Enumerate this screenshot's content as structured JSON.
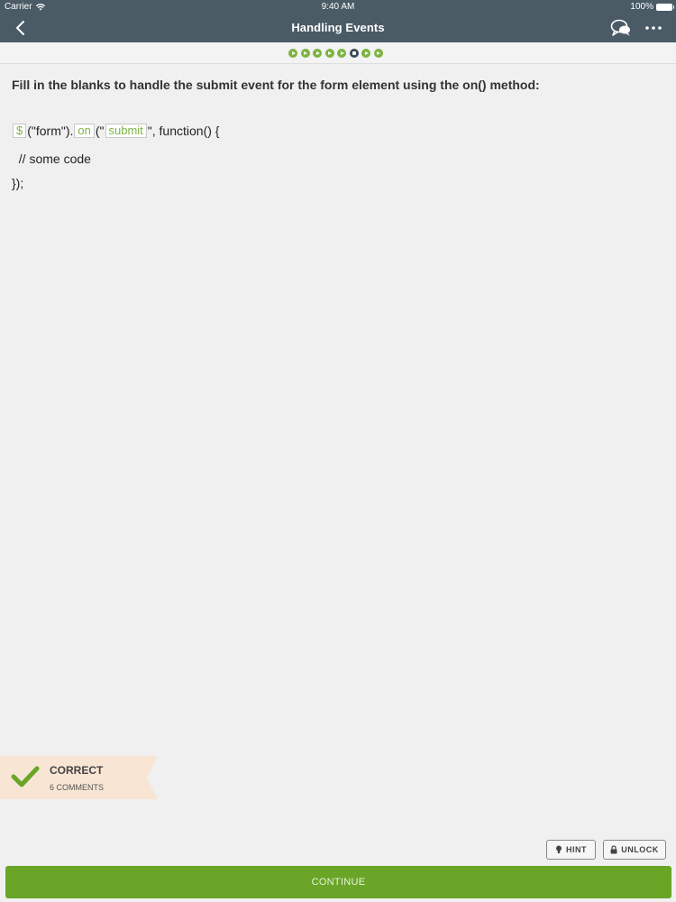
{
  "status_bar": {
    "carrier": "Carrier",
    "time": "9:40 AM",
    "battery": "100%"
  },
  "header": {
    "title": "Handling Events",
    "back_icon": "chevron-left-icon",
    "comments_icon": "chat-bubbles-icon",
    "more_icon": "more-dots-icon"
  },
  "progress": {
    "total": 8,
    "current_index": 5
  },
  "question": {
    "text": "Fill in the blanks to handle the submit event for the form element using the on() method:"
  },
  "code": {
    "line1": {
      "blank1": "$",
      "text1": "(\"form\").",
      "blank2": "on",
      "text2": "(\"",
      "blank3": "submit",
      "text3": "\", function() {"
    },
    "line2": "  // some code",
    "line3": "});"
  },
  "result": {
    "title": "CORRECT",
    "comments": "6 COMMENTS",
    "icon": "check-icon"
  },
  "actions": {
    "hint": "HINT",
    "unlock": "UNLOCK",
    "continue": "CONTINUE"
  },
  "colors": {
    "header": "#4a5b66",
    "accent": "#7cb342",
    "continue": "#6aa527",
    "banner": "#f8e5d4"
  }
}
